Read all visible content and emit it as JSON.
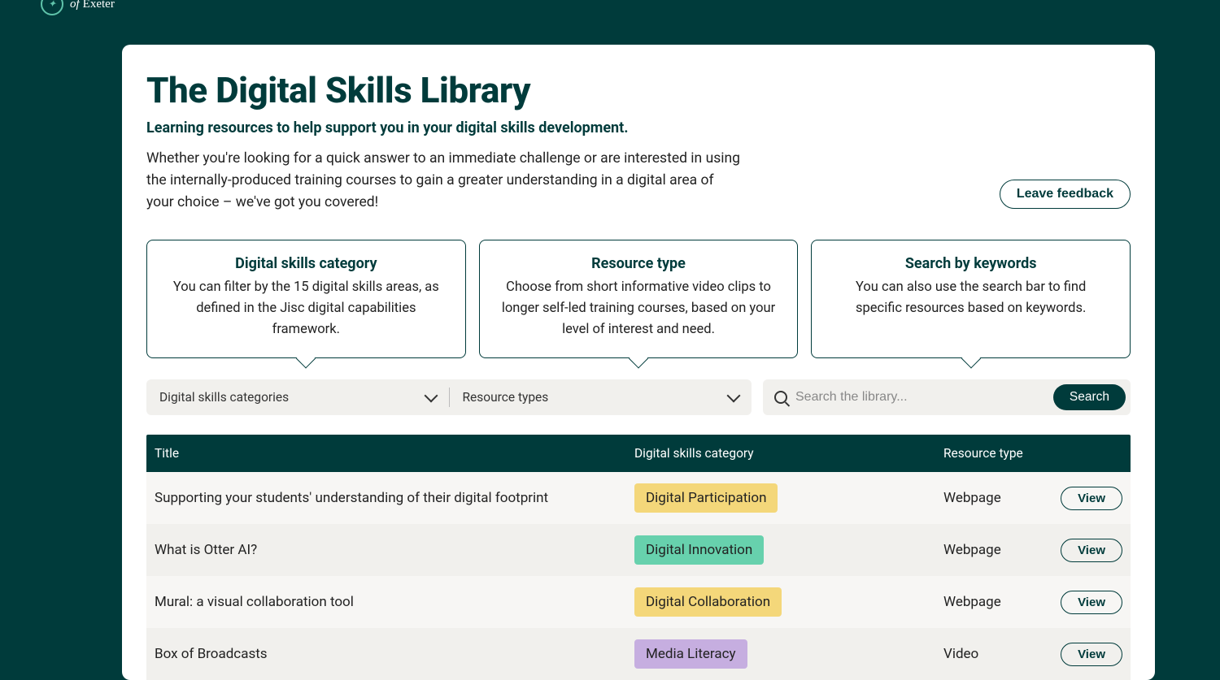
{
  "brand": {
    "of": "of",
    "name": "Exeter"
  },
  "page": {
    "title": "The Digital Skills Library",
    "subtitle": "Learning resources to help support you in your digital skills development.",
    "body": "Whether you're looking for a quick answer to an immediate challenge or are interested in using the internally-produced training courses to gain a greater understanding in a digital area of your choice – we've got you covered!",
    "feedback_label": "Leave feedback"
  },
  "callouts": [
    {
      "title": "Digital skills category",
      "text": "You can filter by the 15 digital skills areas, as defined in the Jisc digital capabilities framework."
    },
    {
      "title": "Resource type",
      "text": "Choose from short informative video clips to longer self-led training courses, based on your level of interest and need."
    },
    {
      "title": "Search by keywords",
      "text": "You can also use the search bar to find specific resources based on keywords."
    }
  ],
  "filters": {
    "categories_label": "Digital skills categories",
    "types_label": "Resource types",
    "search_placeholder": "Search the library...",
    "search_button": "Search"
  },
  "table": {
    "headers": {
      "title": "Title",
      "category": "Digital skills category",
      "type": "Resource type"
    },
    "view_label": "View",
    "rows": [
      {
        "title": "Supporting your students' understanding of their digital footprint",
        "category": "Digital Participation",
        "cat_color": "#f4d77a",
        "type": "Webpage"
      },
      {
        "title": "What is Otter AI?",
        "category": "Digital Innovation",
        "cat_color": "#67d1ad",
        "type": "Webpage"
      },
      {
        "title": "Mural: a visual collaboration tool",
        "category": "Digital Collaboration",
        "cat_color": "#f4d77a",
        "type": "Webpage"
      },
      {
        "title": "Box of Broadcasts",
        "category": "Media Literacy",
        "cat_color": "#c6aee0",
        "type": "Video"
      }
    ]
  }
}
